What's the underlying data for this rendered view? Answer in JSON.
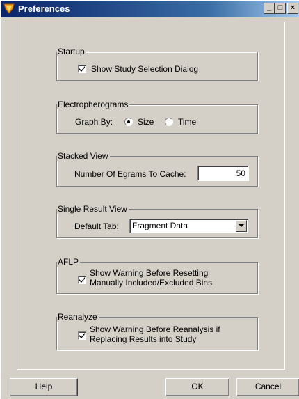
{
  "window": {
    "title": "Preferences",
    "icon": "shield-icon"
  },
  "titlebar_buttons": {
    "minimize": "_",
    "maximize": "□",
    "close": "×"
  },
  "startup": {
    "legend": "Startup",
    "show_dialog_label": "Show Study Selection Dialog",
    "show_dialog_checked": true
  },
  "electropherograms": {
    "legend": "Electropherograms",
    "graph_by_label": "Graph By:",
    "option_size": "Size",
    "option_time": "Time",
    "selected": "Size"
  },
  "stacked_view": {
    "legend": "Stacked View",
    "cache_label": "Number Of Egrams To Cache:",
    "cache_value": "50"
  },
  "single_result_view": {
    "legend": "Single Result View",
    "default_tab_label": "Default Tab:",
    "default_tab_value": "Fragment Data"
  },
  "aflp": {
    "legend": "AFLP",
    "warning_line1": "Show Warning Before Resetting",
    "warning_line2": "Manually Included/Excluded Bins",
    "checked": true
  },
  "reanalyze": {
    "legend": "Reanalyze",
    "warning_line1": "Show Warning Before Reanalysis if",
    "warning_line2": "Replacing Results into Study",
    "checked": true
  },
  "buttons": {
    "help": "Help",
    "ok": "OK",
    "cancel": "Cancel"
  }
}
